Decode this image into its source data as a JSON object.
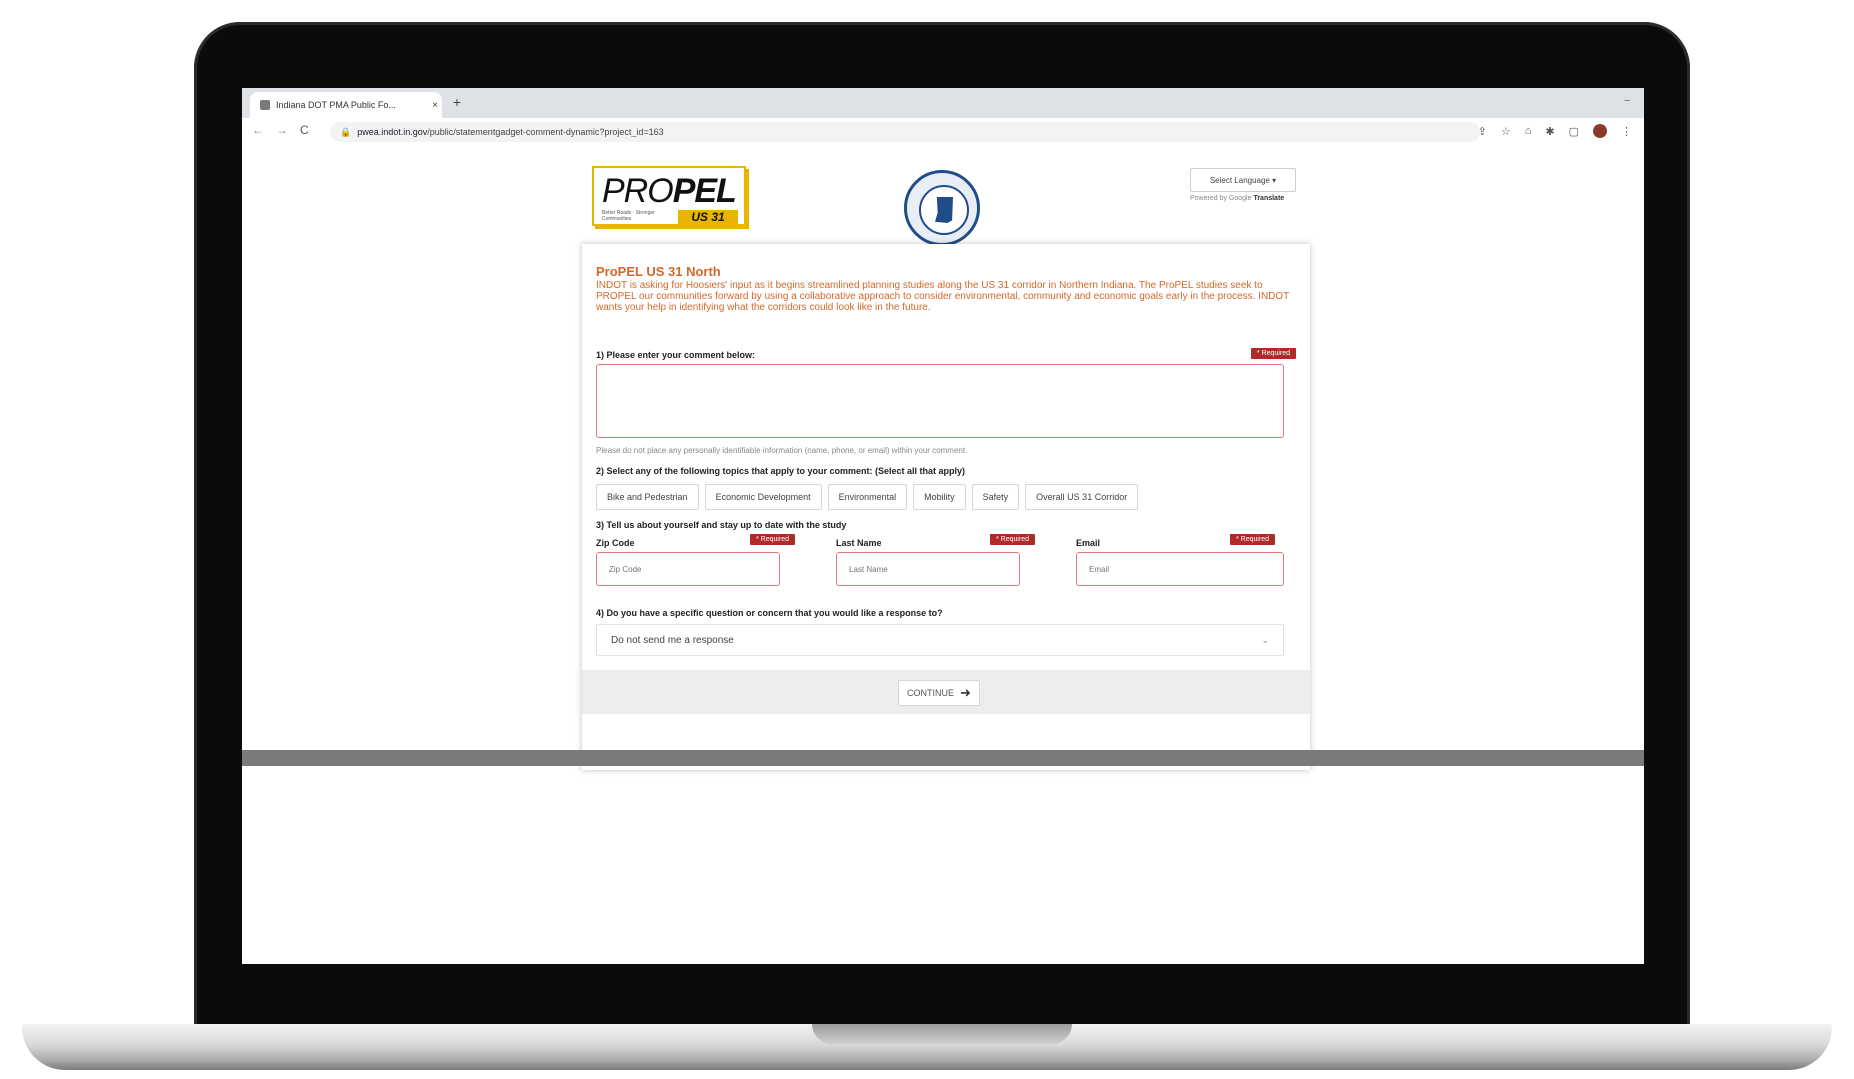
{
  "browser": {
    "tab_title": "Indiana DOT PMA Public Fo...",
    "tab_close": "×",
    "new_tab": "+",
    "window_controls": "–",
    "url_host": "pwea.indot.in.gov",
    "url_path": "/public/statementgadget-comment-dynamic?project_id=163",
    "nav_back": "←",
    "nav_forward": "→",
    "nav_reload": "C",
    "lock": "🔒"
  },
  "header": {
    "logo_word_light": "PRO",
    "logo_word_bold": "PEL",
    "logo_sub": "Better Roads · Stronger Communities",
    "logo_badge": "US 31",
    "language_select": "Select Language ▾",
    "powered_by": "Powered by Google",
    "powered_brand": "Translate"
  },
  "form": {
    "title": "ProPEL US 31 North",
    "description": "INDOT is asking for Hoosiers' input as it begins streamlined planning studies along the US 31 corridor in Northern Indiana. The ProPEL studies seek to PROPEL our communities forward by using a collaborative approach to consider environmental, community and economic goals early in the process. INDOT wants your help in identifying what the corridors could look like in the future.",
    "q1_label": "1) Please enter your comment below:",
    "required_label": "* Required",
    "comment_hint": "Please do not place any personally identifiable information (name, phone, or email) within your comment.",
    "q2_label": "2) Select any of the following topics that apply to your comment: (Select all that apply)",
    "topics": [
      "Bike and Pedestrian",
      "Economic Development",
      "Environmental",
      "Mobility",
      "Safety",
      "Overall US 31 Corridor"
    ],
    "q3_label": "3) Tell us about yourself and stay up to date with the study",
    "zip_label": "Zip Code",
    "zip_placeholder": "Zip Code",
    "last_name_label": "Last Name",
    "last_name_placeholder": "Last Name",
    "email_label": "Email",
    "email_placeholder": "Email",
    "q4_label": "4) Do you have a specific question or concern that you would like a response to?",
    "response_select": "Do not send me a response",
    "continue_label": "CONTINUE",
    "continue_arrow": "➜"
  }
}
